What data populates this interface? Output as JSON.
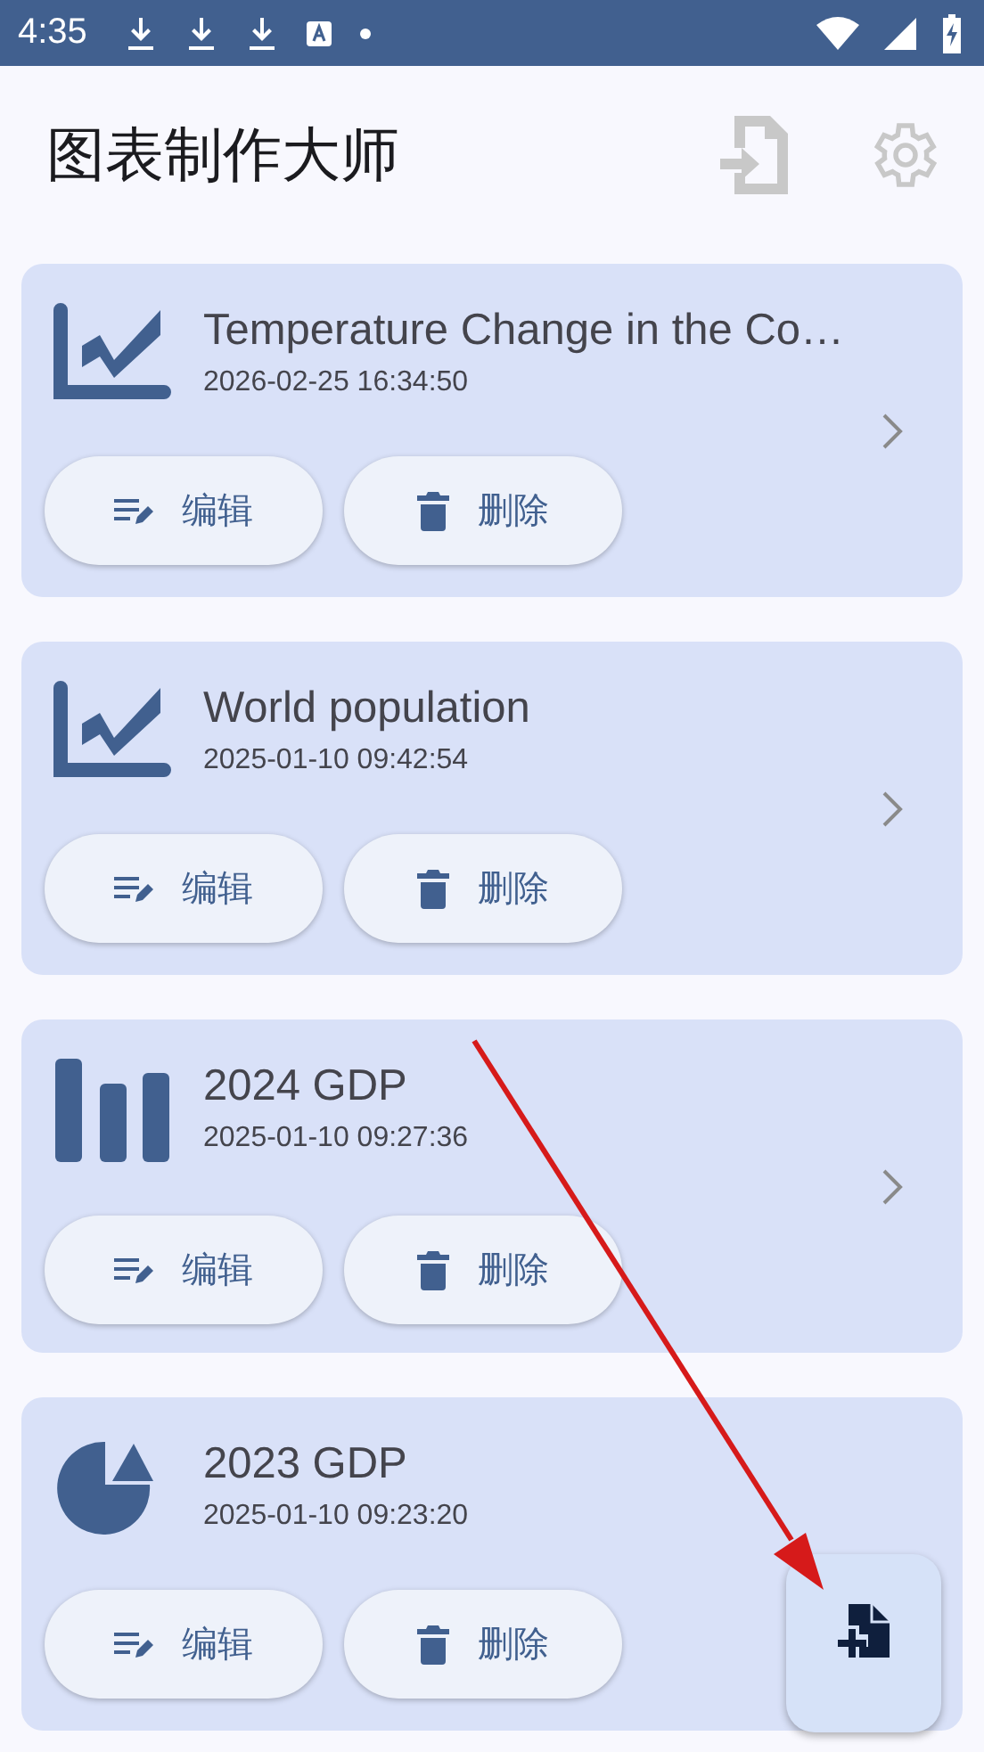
{
  "status_bar": {
    "time": "4:35"
  },
  "app_bar": {
    "title": "图表制作大师"
  },
  "charts": [
    {
      "kind": "line",
      "title": "Temperature Change in the Co…",
      "date": "2026-02-25 16:34:50",
      "edit": "编辑",
      "delete": "删除"
    },
    {
      "kind": "line",
      "title": "World population",
      "date": "2025-01-10 09:42:54",
      "edit": "编辑",
      "delete": "删除"
    },
    {
      "kind": "bar",
      "title": "2024 GDP",
      "date": "2025-01-10 09:27:36",
      "edit": "编辑",
      "delete": "删除"
    },
    {
      "kind": "pie",
      "title": "2023 GDP",
      "date": "2025-01-10 09:23:20",
      "edit": "编辑",
      "delete": "删除"
    }
  ]
}
